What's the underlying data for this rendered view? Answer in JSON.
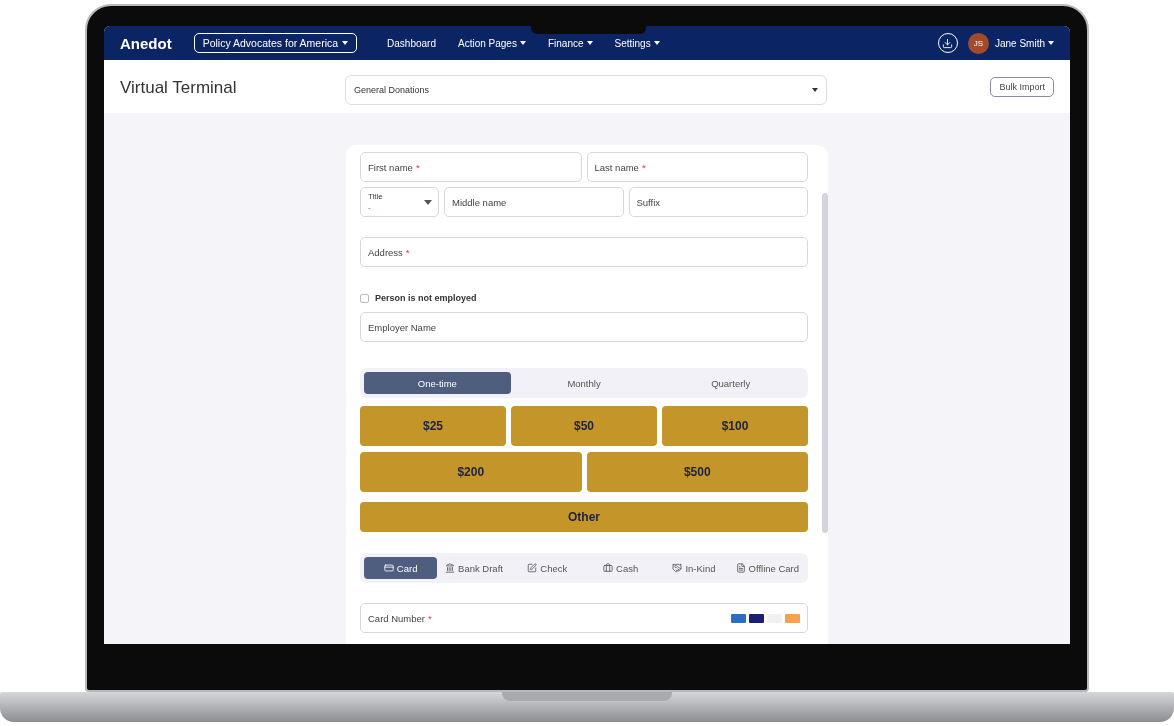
{
  "navbar": {
    "logo": "Anedot",
    "organization": "Policy Advocates for America",
    "links": [
      {
        "label": "Dashboard",
        "dropdown": false
      },
      {
        "label": "Action Pages",
        "dropdown": true
      },
      {
        "label": "Finance",
        "dropdown": true
      },
      {
        "label": "Settings",
        "dropdown": true
      }
    ],
    "user": {
      "initials": "JS",
      "name": "Jane Smith"
    }
  },
  "header": {
    "title": "Virtual Terminal",
    "page_select": "General Donations",
    "bulk_import": "Bulk Import"
  },
  "form": {
    "name_fields": [
      {
        "placeholder": "First name",
        "mark": "*"
      },
      {
        "placeholder": "Last name",
        "mark": "*"
      }
    ],
    "title_select": {
      "label": "Title",
      "value": "-"
    },
    "other_name_fields": [
      {
        "placeholder": "Middle name"
      },
      {
        "placeholder": "Suffix"
      }
    ],
    "address": {
      "placeholder": "Address",
      "mark": "*"
    },
    "not_employed": {
      "label": "Person is not employed",
      "checked": false
    },
    "employer": {
      "placeholder": "Employer Name"
    },
    "frequencies": [
      {
        "label": "One-time",
        "selected": true
      },
      {
        "label": "Monthly",
        "selected": false
      },
      {
        "label": "Quarterly",
        "selected": false
      }
    ],
    "amount_rows": [
      [
        "$25",
        "$50",
        "$100"
      ],
      [
        "$200",
        "$500"
      ],
      [
        "Other"
      ]
    ],
    "payment_methods": [
      {
        "label": "Card",
        "kind": "card",
        "selected": true
      },
      {
        "label": "Bank Draft",
        "kind": "bank",
        "selected": false
      },
      {
        "label": "Check",
        "kind": "check",
        "selected": false
      },
      {
        "label": "Cash",
        "kind": "cash",
        "selected": false
      },
      {
        "label": "In-Kind",
        "kind": "inkind",
        "selected": false
      },
      {
        "label": "Offline Card",
        "kind": "offline",
        "selected": false
      }
    ],
    "card_number": {
      "placeholder": "Card Number",
      "mark": "*"
    }
  }
}
